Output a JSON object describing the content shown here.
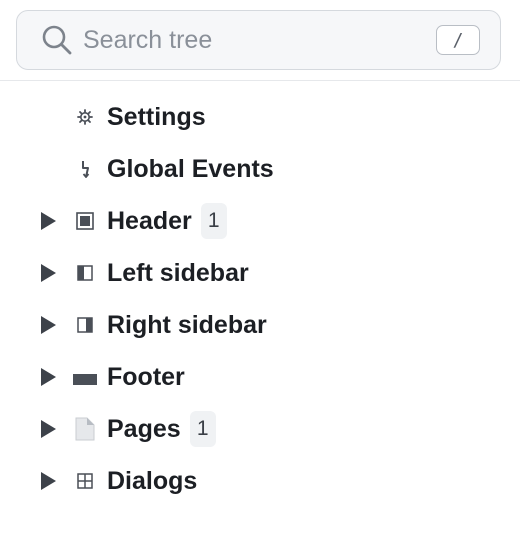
{
  "search": {
    "placeholder": "Search tree",
    "shortcut": "/"
  },
  "tree": {
    "items": [
      {
        "label": "Settings",
        "icon": "gear-icon",
        "expandable": false
      },
      {
        "label": "Global Events",
        "icon": "lightning-icon",
        "expandable": false
      },
      {
        "label": "Header",
        "icon": "header-icon",
        "expandable": true,
        "badge": "1"
      },
      {
        "label": "Left sidebar",
        "icon": "left-sidebar-icon",
        "expandable": true
      },
      {
        "label": "Right sidebar",
        "icon": "right-sidebar-icon",
        "expandable": true
      },
      {
        "label": "Footer",
        "icon": "footer-icon",
        "expandable": true
      },
      {
        "label": "Pages",
        "icon": "page-icon",
        "expandable": true,
        "badge": "1"
      },
      {
        "label": "Dialogs",
        "icon": "dialogs-icon",
        "expandable": true
      }
    ]
  },
  "colors": {
    "caret": "#3d424a",
    "icon": "#4a4f57",
    "badge_bg": "#f0f2f4"
  }
}
